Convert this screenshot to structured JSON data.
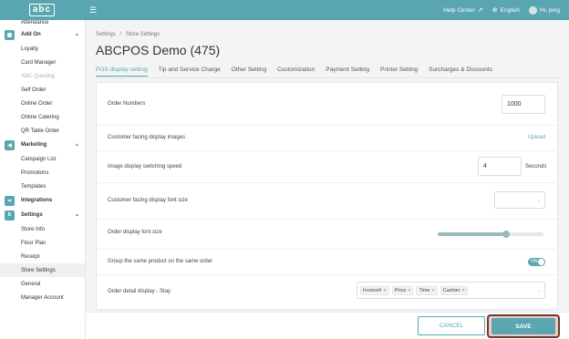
{
  "header": {
    "logo_text": "abc",
    "help_center": "Help Center",
    "language": "English",
    "greeting": "Hi, ping",
    "accent": "#5aa6b0"
  },
  "sidebar": {
    "top_item": "Attendance",
    "add_on": {
      "label": "Add On",
      "items": [
        "Loyalty",
        "Card Manager",
        "ABC Queuing",
        "Self Order",
        "Online Order",
        "Online Catering",
        "QR Table Order"
      ]
    },
    "marketing": {
      "label": "Marketing",
      "items": [
        "Campaign List",
        "Promotions",
        "Templates"
      ]
    },
    "integrations": {
      "label": "Integrations"
    },
    "settings": {
      "label": "Settings",
      "items": [
        "Store Info",
        "Floor Plan",
        "Receipt",
        "Store Settings",
        "General",
        "Manager Account"
      ]
    }
  },
  "breadcrumb": {
    "first": "Settings",
    "sep": "/",
    "second": "Store Settings"
  },
  "page_title": "ABCPOS Demo (475)",
  "tabs": [
    "POS display setting",
    "Tip and Service Charge",
    "Other Setting",
    "Customization",
    "Payment Setting",
    "Printer Setting",
    "Surcharges & Discounts"
  ],
  "rows": {
    "order_numbers": {
      "label": "Order Numbers",
      "value": "1000"
    },
    "customer_display_images": {
      "label": "Customer facing display images",
      "action": "Upload"
    },
    "switching_speed": {
      "label": "Image display switching speed",
      "value": "4",
      "unit": "Seconds"
    },
    "customer_font_size": {
      "label": "Customer facing display font size",
      "value": ""
    },
    "order_font_size": {
      "label": "Order display font size",
      "level": 0.65
    },
    "group_same_product": {
      "label": "Group the same product on the same order",
      "toggle_text": "ON",
      "enabled": true
    },
    "order_detail_stay": {
      "label": "Order detail display - Stay",
      "tags": [
        "Invoice#",
        "Price",
        "Time",
        "Cashier"
      ]
    }
  },
  "footer": {
    "cancel": "CANCEL",
    "save": "SAVE"
  }
}
